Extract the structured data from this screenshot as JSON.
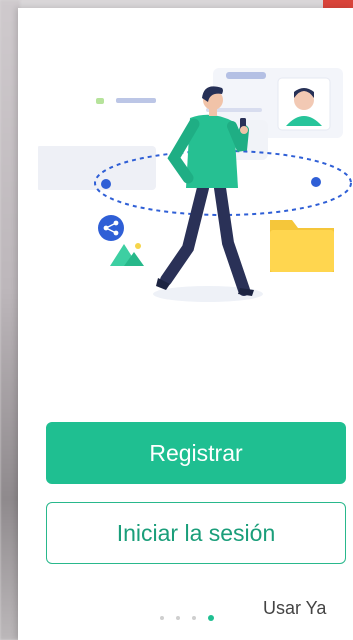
{
  "onboarding": {
    "register_label": "Registrar",
    "login_label": "Iniciar la sesión",
    "skip_label": "Usar Ya",
    "pager": {
      "total": 4,
      "active_index": 3
    }
  },
  "colors": {
    "primary": "#1fbf91",
    "primary_text": "#1a9e7a",
    "inactive_dot": "#cfcfcf"
  },
  "illustration": {
    "icons": [
      "person-walking-with-phone",
      "share-icon",
      "folder-icon",
      "image-icon",
      "profile-card-icon"
    ]
  }
}
